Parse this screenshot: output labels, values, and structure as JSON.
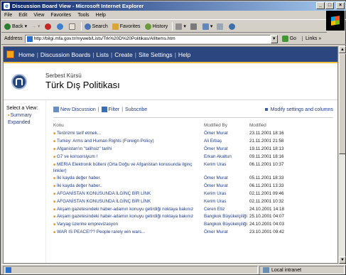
{
  "window": {
    "title": "Discussion Board View - Microsoft Internet Explorer",
    "min": "_",
    "max": "□",
    "close": "×"
  },
  "menu": [
    "File",
    "Edit",
    "View",
    "Favorites",
    "Tools",
    "Help"
  ],
  "toolbar": {
    "back": "Back",
    "search": "Search",
    "favorites": "Favorites",
    "history": "History"
  },
  "address": {
    "label": "Address",
    "url": "http://bilgi.mfa.gov.tr/myweb/Lists/Trk%20D%20Politikas/AllItems.htm",
    "go": "Go",
    "links": "Links »"
  },
  "sp": {
    "nav": [
      "Home",
      "Discussion Boards",
      "Lists",
      "Create",
      "Site Settings",
      "Help"
    ],
    "subtitle": "Serbest Kürsü",
    "title": "Türk Dış Politikası",
    "leftnav": {
      "heading": "Select a View:",
      "items": [
        "Summary",
        "Expanded"
      ]
    },
    "actions": {
      "new_discussion": "New Discussion",
      "filter": "Filter",
      "subscribe": "Subscribe",
      "modify": "Modify settings and columns"
    },
    "columns": {
      "topic": "Konu",
      "by": "Modified By",
      "modified": "Modified"
    },
    "rows": [
      {
        "title": "Terörizmi tarif etmek...",
        "by": "Ömer Murat",
        "modified": "23.11.2001 18:16",
        "level": 0
      },
      {
        "title": "Turkey: Arms and Human Rights (Foreign Policy)",
        "by": "Ali Erbaş",
        "modified": "21.11.2001 21:58",
        "level": 0
      },
      {
        "title": "Afganistan'ın \"talihsiz\" tarihi",
        "by": "Ömer Murat",
        "modified": "19.11.2001 18:13",
        "level": 0
      },
      {
        "title": "G7 ve konsorsiyum !",
        "by": "Erkan Akaltun",
        "modified": "09.11.2001 18:16",
        "level": 0
      },
      {
        "title": "MERIA Elektronik bülteni (Orta Doğu ve Afganistan konusunda ilginç linkler)",
        "by": "Kerim Uras",
        "modified": "06.11.2001 10:37",
        "level": 0
      },
      {
        "title": "İki kayda değer haber.",
        "by": "Ömer Murat",
        "modified": "05.11.2001 18:33",
        "level": 0
      },
      {
        "title": "İki kayda değer haber..",
        "by": "Ömer Murat",
        "modified": "06.11.2001 13:33",
        "level": 1
      },
      {
        "title": "AFGANİSTAN KONUSUNDA İLGİNÇ BİR LİNK",
        "by": "Kerim Uras",
        "modified": "02.11.2001 09:46",
        "level": 0
      },
      {
        "title": "AFGANİSTAN KONUSUNDA İLGİNÇ BİR LİNK",
        "by": "Kerim Uras",
        "modified": "02.11.2001 10:32",
        "level": 1
      },
      {
        "title": "Akşam gazetesindeki haber-adamın konuyu getirdiği noktaya bakınız",
        "by": "Ceren Etiz",
        "modified": "24.10.2001 14:18",
        "level": 0
      },
      {
        "title": "Akşam gazetesindeki haber-adamın konuyu getirdiği noktaya bakınız",
        "by": "Bangkok Büyükelçiliği",
        "modified": "25.10.2001 04:07",
        "level": 1
      },
      {
        "title": "Varyag üzerine emprevizasyon",
        "by": "Bangkok Büyükelçiliği",
        "modified": "24.10.2001 04:03",
        "level": 0
      },
      {
        "title": "WAR IS PEACE!?? People rarely win wars...",
        "by": "Ömer Murat",
        "modified": "23.10.2001 09:42",
        "level": 0
      }
    ]
  },
  "status": {
    "zone": "Local intranet"
  },
  "colors": {
    "nav_bg": "#2c4780",
    "link": "#1e3b8c",
    "bullet": "#f08a00",
    "titlebar_from": "#0a246a",
    "titlebar_to": "#a6caf0"
  }
}
